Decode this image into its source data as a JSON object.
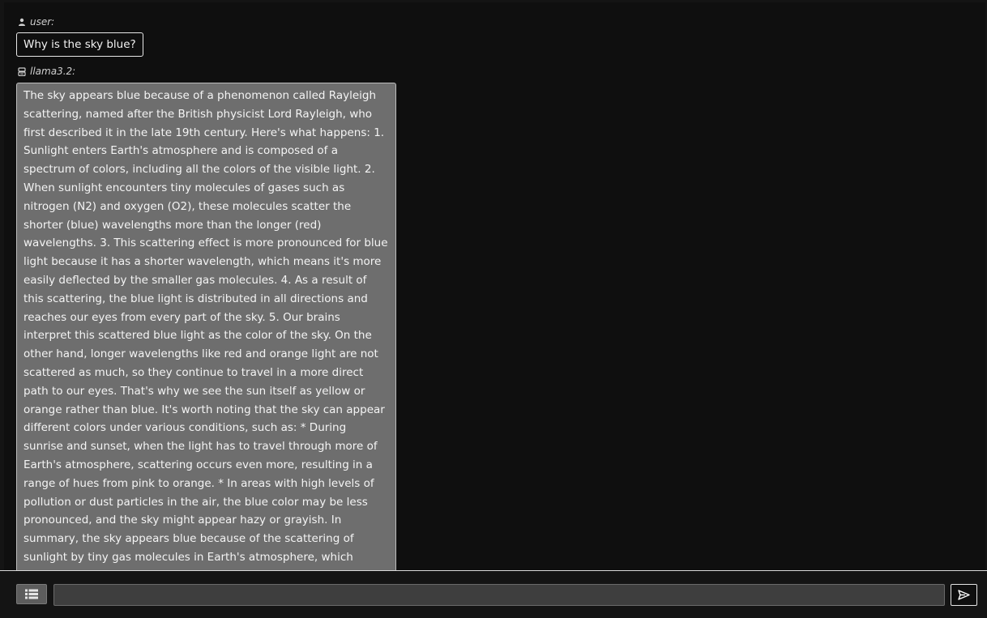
{
  "conversation": {
    "user_label": "user:",
    "user_icon": "user-icon",
    "user_message": "Why is the sky blue?",
    "assistant_label": "llama3.2:",
    "assistant_icon": "robot-icon",
    "assistant_message": "The sky appears blue because of a phenomenon called Rayleigh scattering, named after the British physicist Lord Rayleigh, who first described it in the late 19th century. Here's what happens: 1. Sunlight enters Earth's atmosphere and is composed of a spectrum of colors, including all the colors of the visible light. 2. When sunlight encounters tiny molecules of gases such as nitrogen (N2) and oxygen (O2), these molecules scatter the shorter (blue) wavelengths more than the longer (red) wavelengths. 3. This scattering effect is more pronounced for blue light because it has a shorter wavelength, which means it's more easily deflected by the smaller gas molecules. 4. As a result of this scattering, the blue light is distributed in all directions and reaches our eyes from every part of the sky. 5. Our brains interpret this scattered blue light as the color of the sky. On the other hand, longer wavelengths like red and orange light are not scattered as much, so they continue to travel in a more direct path to our eyes. That's why we see the sun itself as yellow or orange rather than blue. It's worth noting that the sky can appear different colors under various conditions, such as: * During sunrise and sunset, when the light has to travel through more of Earth's atmosphere, scattering occurs even more, resulting in a range of hues from pink to orange. * In areas with high levels of pollution or dust particles in the air, the blue color may be less pronounced, and the sky might appear hazy or grayish. In summary, the sky appears blue because of the scattering of sunlight by tiny gas molecules in Earth's atmosphere, which preferentially scatters shorter (blue) wavelengths more than longer (red) wavelengths."
  },
  "composer": {
    "menu_icon": "list-icon",
    "input_value": "",
    "input_placeholder": "",
    "send_icon": "send-icon"
  },
  "colors": {
    "background": "#0f0f0f",
    "assistant_bubble": "#6e6e6e",
    "input_background": "#3e3e3e",
    "menu_button": "#5d5d5d",
    "text": "#f4f4f4"
  }
}
